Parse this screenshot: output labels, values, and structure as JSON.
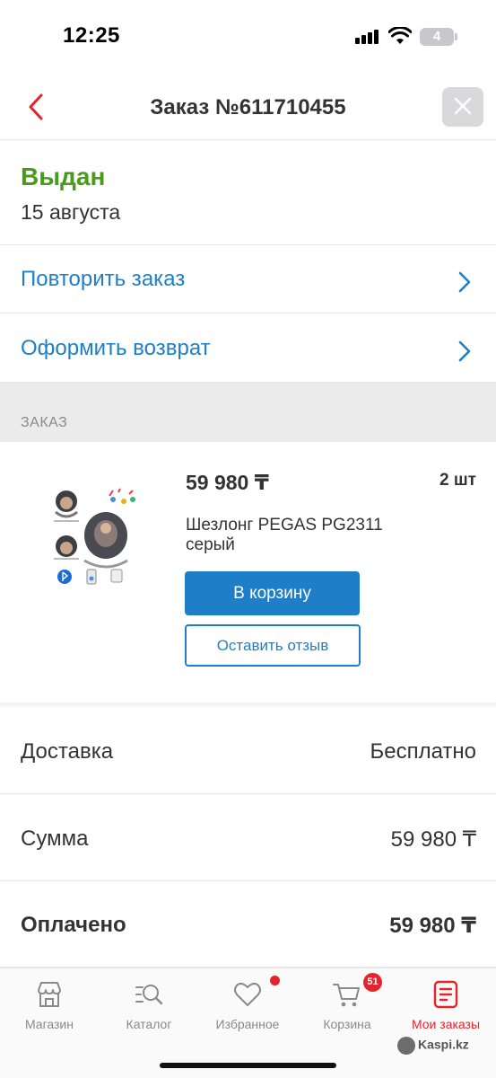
{
  "status_bar": {
    "time": "12:25",
    "battery": "4"
  },
  "header": {
    "title": "Заказ №611710455"
  },
  "order_status": {
    "status": "Выдан",
    "date": "15 августа"
  },
  "actions": [
    {
      "label": "Повторить заказ"
    },
    {
      "label": "Оформить возврат"
    }
  ],
  "section": {
    "title": "ЗАКАЗ"
  },
  "product": {
    "price": "59 980 ₸",
    "quantity": "2 шт",
    "name": "Шезлонг PEGAS PG2311 серый",
    "cart_button": "В корзину",
    "review_button": "Оставить отзыв"
  },
  "summary": [
    {
      "label": "Доставка",
      "value": "Бесплатно"
    },
    {
      "label": "Сумма",
      "value": "59 980 ₸"
    },
    {
      "label": "Оплачено",
      "value": "59 980 ₸"
    }
  ],
  "tabbar": {
    "items": [
      {
        "label": "Магазин",
        "icon": "store-icon"
      },
      {
        "label": "Каталог",
        "icon": "catalog-search-icon"
      },
      {
        "label": "Избранное",
        "icon": "heart-icon"
      },
      {
        "label": "Корзина",
        "icon": "cart-icon"
      },
      {
        "label": "Мои заказы",
        "icon": "orders-icon"
      }
    ],
    "cart_count": "51"
  },
  "watermark": "Kaspi.kz",
  "colors": {
    "accent": "#1e7fc8",
    "success": "#4a9a1b",
    "active_tab": "#e3242b"
  }
}
